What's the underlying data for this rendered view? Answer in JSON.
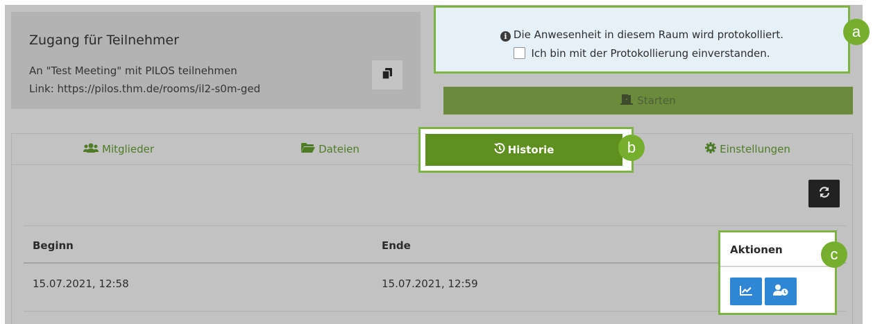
{
  "access": {
    "title": "Zugang für Teilnehmer",
    "line1": "An \"Test Meeting\" mit PILOS teilnehmen",
    "line2": "Link: https://pilos.thm.de/rooms/il2-s0m-ged",
    "copy_icon": "copy-icon"
  },
  "notice": {
    "info_glyph": "i",
    "recording_text": "Die Anwesenheit in diesem Raum wird protokolliert.",
    "consent_label": "Ich bin mit der Protokollierung einverstanden.",
    "consent_checked": false
  },
  "start": {
    "label": "Starten",
    "icon": "door-icon"
  },
  "tabs": [
    {
      "label": "Mitglieder",
      "icon": "users-icon"
    },
    {
      "label": "Dateien",
      "icon": "folder-icon"
    },
    {
      "label": "Historie",
      "icon": "history-icon",
      "active": true
    },
    {
      "label": "Einstellungen",
      "icon": "gear-icon"
    }
  ],
  "history": {
    "refresh_icon": "refresh-icon",
    "columns": {
      "begin": "Beginn",
      "end": "Ende",
      "actions": "Aktionen"
    },
    "rows": [
      {
        "begin": "15.07.2021, 12:58",
        "end": "15.07.2021, 12:59"
      }
    ],
    "action_icons": [
      "chart-line-icon",
      "user-clock-icon"
    ]
  },
  "badges": {
    "a": "a",
    "b": "b",
    "c": "c"
  },
  "colors": {
    "accent_green": "#7cb342",
    "tab_active": "#5e8f1f",
    "action_blue": "#2f86d4",
    "notice_bg": "#e6f0f8"
  }
}
